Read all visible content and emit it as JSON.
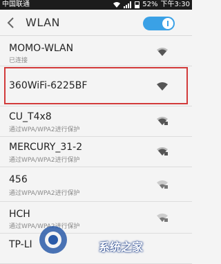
{
  "status_bar": {
    "carrier": "中国联通",
    "battery": "52%",
    "time": "下午3:30"
  },
  "header": {
    "title": "WLAN",
    "toggle_state": "on",
    "accent": "#3aa1e6"
  },
  "networks": [
    {
      "name": "MOMO-WLAN",
      "status": "已连接",
      "signal_icon": "wifi-icon"
    },
    {
      "name": "360WiFi-6225BF",
      "status": "",
      "signal_icon": "wifi-icon"
    },
    {
      "name": "CU_T4x8",
      "status": "通过WPA/WPA2进行保护",
      "signal_icon": "wifi-lock-icon"
    },
    {
      "name": "MERCURY_31-2",
      "status": "通过WPA/WPA2进行保护",
      "signal_icon": "wifi-lock-icon"
    },
    {
      "name": "456",
      "status": "通过WPA/WPA2进行保护",
      "signal_icon": "wifi-lock-icon"
    },
    {
      "name": "HCH",
      "status": "通过WPA/WPA2进行保护",
      "signal_icon": "wifi-lock-icon"
    },
    {
      "name": "TP-LI",
      "status": "",
      "signal_icon": "wifi-lock-icon"
    }
  ],
  "watermark": {
    "text": "系统之家",
    "logo_name": "system-home-logo"
  },
  "colors": {
    "highlight_border": "#d23a3a",
    "status_bar_bg": "#1c1c1c"
  }
}
